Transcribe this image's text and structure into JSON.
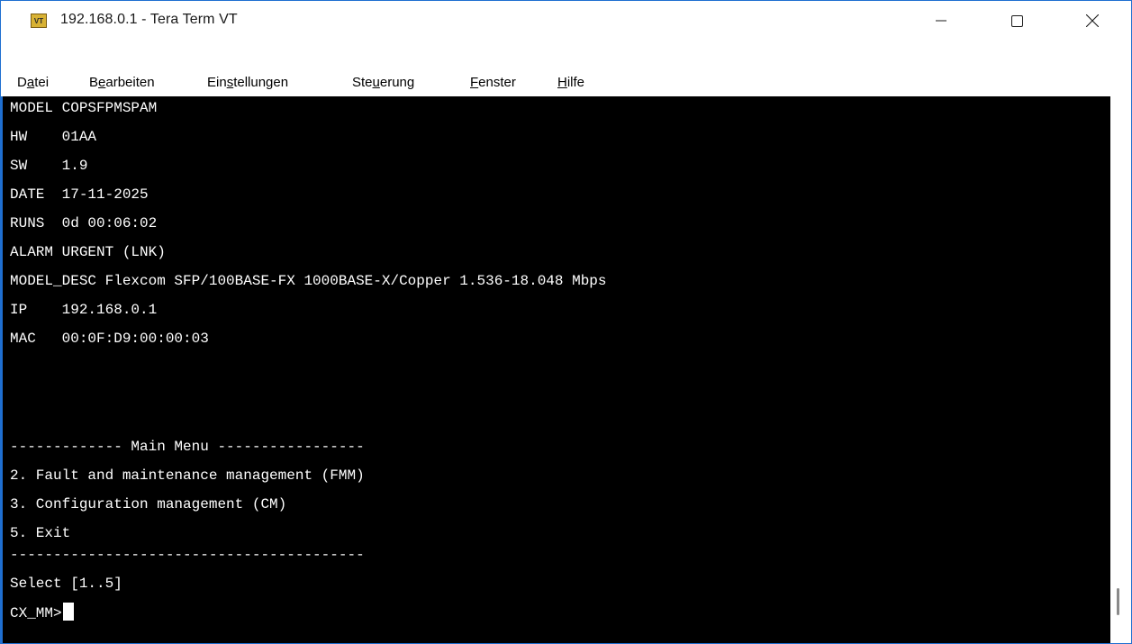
{
  "window": {
    "title": "192.168.0.1 - Tera Term VT",
    "icon": "vt-terminal-icon",
    "icon_label": "VT",
    "accent_color": "#1f6fd0"
  },
  "menu": {
    "items": [
      {
        "prefix": "D",
        "mnemonic": "a",
        "suffix": "tei"
      },
      {
        "prefix": "B",
        "mnemonic": "e",
        "suffix": "arbeiten"
      },
      {
        "prefix": "Ein",
        "mnemonic": "s",
        "suffix": "tellungen"
      },
      {
        "prefix": "Ste",
        "mnemonic": "u",
        "suffix": "erung"
      },
      {
        "prefix": "",
        "mnemonic": "F",
        "suffix": "enster"
      },
      {
        "prefix": "",
        "mnemonic": "H",
        "suffix": "ilfe"
      }
    ]
  },
  "terminal": {
    "background": "#000000",
    "foreground": "#ffffff",
    "lines": [
      "MODEL COPSFPMSPAM",
      "HW    01AA",
      "SW    1.9",
      "DATE  17-11-2025",
      "RUNS  0d 00:06:02",
      "ALARM URGENT (LNK)",
      "MODEL_DESC Flexcom SFP/100BASE-FX 1000BASE-X/Copper 1.536-18.048 Mbps",
      "IP    192.168.0.1",
      "MAC   00:0F:D9:00:00:03",
      "",
      "",
      "",
      "------------- Main Menu -----------------",
      "2. Fault and maintenance management (FMM)",
      "3. Configuration management (CM)",
      "5. Exit",
      "-----------------------------------------",
      "Select [1..5]"
    ],
    "prompt": "CX_MM>"
  }
}
